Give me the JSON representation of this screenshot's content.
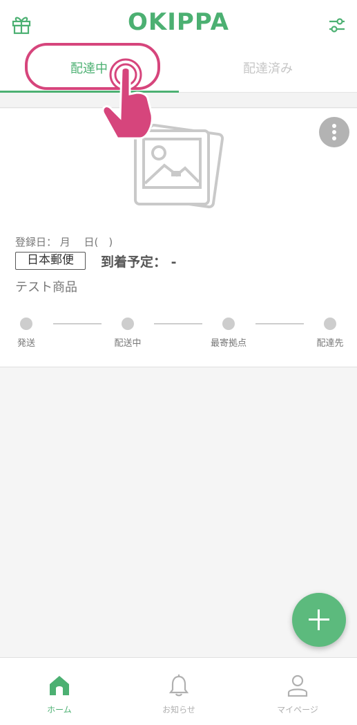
{
  "header": {
    "logo": "OKIPPA",
    "left_icon": "gift-icon",
    "right_icon": "filter-sliders-icon",
    "brand_color": "#4cb072"
  },
  "tabs": [
    {
      "label": "配達中",
      "active": true
    },
    {
      "label": "配達済み",
      "active": false
    }
  ],
  "package": {
    "image_icon": "photo-placeholder-icon",
    "more_icon": "more-vertical-icon",
    "registered_label": "登録日： 月　 日(　)",
    "carrier": "日本郵便",
    "eta_label": "到着予定： -",
    "item_name": "テスト商品",
    "steps": [
      "発送",
      "配送中",
      "最寄拠点",
      "配達先"
    ]
  },
  "fab": {
    "icon": "plus-icon",
    "color": "#5cba7d"
  },
  "bottom_nav": [
    {
      "label": "ホーム",
      "icon": "home-icon",
      "active": true
    },
    {
      "label": "お知らせ",
      "icon": "bell-icon",
      "active": false
    },
    {
      "label": "マイページ",
      "icon": "user-icon",
      "active": false
    }
  ],
  "overlay": {
    "icon": "tap-hand-icon",
    "highlight_color": "#d6457c"
  }
}
